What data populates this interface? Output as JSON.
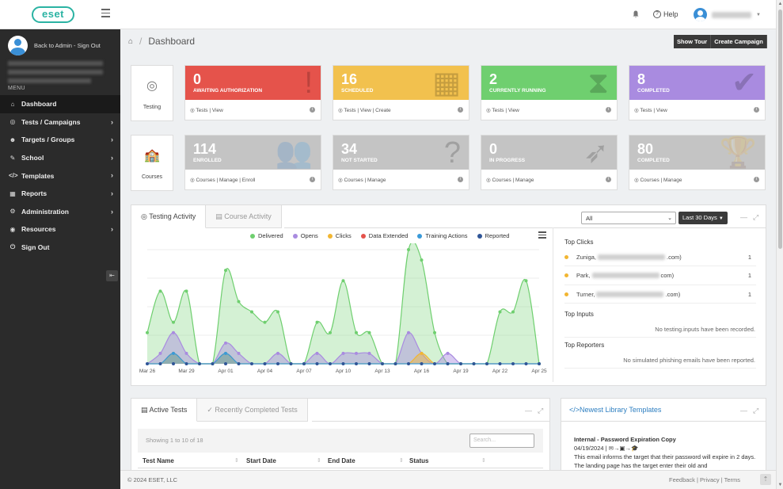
{
  "topbar": {
    "logo": "eset",
    "help_label": "Help"
  },
  "sidebar": {
    "back_link": "Back to Admin",
    "sign_out_link": "Sign Out",
    "menu_label": "MENU",
    "items": [
      {
        "label": "Dashboard",
        "icon": "home-icon",
        "glyph": "⌂",
        "chevron": false
      },
      {
        "label": "Tests / Campaigns",
        "icon": "campaign-icon",
        "glyph": "◎",
        "chevron": true
      },
      {
        "label": "Targets / Groups",
        "icon": "users-icon",
        "glyph": "☻",
        "chevron": true
      },
      {
        "label": "School",
        "icon": "school-icon",
        "glyph": "✎",
        "chevron": true
      },
      {
        "label": "Templates",
        "icon": "code-icon",
        "glyph": "</>",
        "chevron": true
      },
      {
        "label": "Reports",
        "icon": "chart-icon",
        "glyph": "▦",
        "chevron": true
      },
      {
        "label": "Administration",
        "icon": "admin-icon",
        "glyph": "⚙",
        "chevron": true
      },
      {
        "label": "Resources",
        "icon": "resources-icon",
        "glyph": "◉",
        "chevron": true
      },
      {
        "label": "Sign Out",
        "icon": "power-icon",
        "glyph": "⏻",
        "chevron": false
      }
    ]
  },
  "breadcrumb": {
    "title": "Dashboard"
  },
  "buttons": {
    "show_tour": "Show Tour",
    "create_campaign": "Create Campaign"
  },
  "testing_row": {
    "label": "Testing",
    "cards": [
      {
        "num": "0",
        "label": "AWAITING AUTHORIZATION",
        "color": "#e5534b",
        "links": "Tests | View",
        "bg": "!"
      },
      {
        "num": "16",
        "label": "SCHEDULED",
        "color": "#f2c14e",
        "links": "Tests | View | Create",
        "bg": "▦"
      },
      {
        "num": "2",
        "label": "CURRENTLY RUNNING",
        "color": "#6fcf6f",
        "links": "Tests | View",
        "bg": "⧗"
      },
      {
        "num": "8",
        "label": "COMPLETED",
        "color": "#a98be0",
        "links": "Tests | View",
        "bg": "✔"
      }
    ]
  },
  "courses_row": {
    "label": "Courses",
    "cards": [
      {
        "num": "114",
        "label": "ENROLLED",
        "color": "#c4c4c4",
        "links": "Courses | Manage | Enroll",
        "bg": "👥"
      },
      {
        "num": "34",
        "label": "NOT STARTED",
        "color": "#c4c4c4",
        "links": "Courses | Manage",
        "bg": "?"
      },
      {
        "num": "0",
        "label": "IN PROGRESS",
        "color": "#c4c4c4",
        "links": "Courses | Manage",
        "bg": "➶"
      },
      {
        "num": "80",
        "label": "COMPLETED",
        "color": "#c4c4c4",
        "links": "Courses | Manage",
        "bg": "🏆"
      }
    ]
  },
  "activity": {
    "tab_testing": "Testing Activity",
    "tab_course": "Course Activity",
    "filter_value": "All",
    "range_value": "Last 30 Days",
    "top_clicks_title": "Top Clicks",
    "top_clicks": [
      {
        "name": "Zuniga,",
        "suffix": ".com)",
        "count": "1"
      },
      {
        "name": "Park,",
        "suffix": "com)",
        "count": "1"
      },
      {
        "name": "Turner,",
        "suffix": ".com)",
        "count": "1"
      }
    ],
    "top_inputs_title": "Top Inputs",
    "top_inputs_empty": "No testing.inputs have been recorded.",
    "top_reporters_title": "Top Reporters",
    "top_reporters_empty": "No simulated phishing emails have been reported."
  },
  "chart_data": {
    "type": "area",
    "x": [
      "Mar 26",
      "Mar 27",
      "Mar 28",
      "Mar 29",
      "Mar 30",
      "Mar 31",
      "Apr 01",
      "Apr 02",
      "Apr 03",
      "Apr 04",
      "Apr 05",
      "Apr 06",
      "Apr 07",
      "Apr 08",
      "Apr 09",
      "Apr 10",
      "Apr 11",
      "Apr 12",
      "Apr 13",
      "Apr 14",
      "Apr 15",
      "Apr 16",
      "Apr 17",
      "Apr 18",
      "Apr 19",
      "Apr 20",
      "Apr 21",
      "Apr 22",
      "Apr 23",
      "Apr 24",
      "Apr 25"
    ],
    "x_tick_labels": [
      "Mar 26",
      "Mar 29",
      "Apr 01",
      "Apr 04",
      "Apr 07",
      "Apr 10",
      "Apr 13",
      "Apr 16",
      "Apr 19",
      "Apr 22",
      "Apr 25"
    ],
    "ylim": [
      0,
      11
    ],
    "series": [
      {
        "name": "Delivered",
        "color": "#6fcf6f",
        "values": [
          3,
          7,
          4,
          7,
          0,
          0,
          9,
          6,
          5,
          4,
          5,
          0,
          0,
          4,
          3,
          8,
          3,
          3,
          0,
          0,
          11,
          10,
          3,
          0,
          0,
          0,
          0,
          5,
          5,
          8,
          0
        ]
      },
      {
        "name": "Opens",
        "color": "#a98be0",
        "values": [
          0,
          1,
          3,
          1,
          0,
          0,
          2,
          1,
          0,
          0,
          1,
          0,
          0,
          1,
          0,
          1,
          1,
          1,
          0,
          0,
          3,
          1,
          0,
          1,
          0,
          0,
          0,
          0,
          0,
          0,
          0
        ]
      },
      {
        "name": "Clicks",
        "color": "#f2b632",
        "values": [
          0,
          0,
          1,
          0,
          0,
          0,
          1,
          0,
          0,
          0,
          0,
          0,
          0,
          0,
          0,
          0,
          0,
          0,
          0,
          0,
          0,
          1,
          0,
          0,
          0,
          0,
          0,
          0,
          0,
          0,
          0
        ]
      },
      {
        "name": "Data Extended",
        "color": "#e5534b",
        "values": [
          0,
          0,
          0,
          0,
          0,
          0,
          0,
          0,
          0,
          0,
          0,
          0,
          0,
          0,
          0,
          0,
          0,
          0,
          0,
          0,
          0,
          0,
          0,
          0,
          0,
          0,
          0,
          0,
          0,
          0,
          0
        ]
      },
      {
        "name": "Training Actions",
        "color": "#3a9ad9",
        "values": [
          0,
          0,
          1,
          0,
          0,
          0,
          1,
          0,
          0,
          0,
          0,
          0,
          0,
          0,
          0,
          0,
          0,
          0,
          0,
          0,
          0,
          0,
          0,
          0,
          0,
          0,
          0,
          0,
          0,
          0,
          0
        ]
      },
      {
        "name": "Reported",
        "color": "#2f5597",
        "values": [
          0,
          0,
          0,
          0,
          0,
          0,
          0,
          0,
          0,
          0,
          0,
          0,
          0,
          0,
          0,
          0,
          0,
          0,
          0,
          0,
          0,
          0,
          0,
          0,
          0,
          0,
          0,
          0,
          0,
          0,
          0
        ]
      }
    ]
  },
  "active_tests": {
    "tab_active": "Active Tests",
    "tab_completed": "Recently Completed Tests",
    "showing": "Showing 1 to 10 of 18",
    "search_placeholder": "Search...",
    "columns": [
      "Test Name",
      "Start Date",
      "End Date",
      "Status"
    ]
  },
  "library": {
    "title": "Newest Library Templates",
    "item_title": "Internal - Password Expiration Copy",
    "item_date": "04/19/2024",
    "item_flow": "✉→▣→🎓",
    "item_desc": "This email informs the target that their password will expire in 2 days. The landing page has the target enter their old and"
  },
  "footer": {
    "copyright": "© 2024 ESET, LLC",
    "links": "Feedback | Privacy | Terms"
  }
}
